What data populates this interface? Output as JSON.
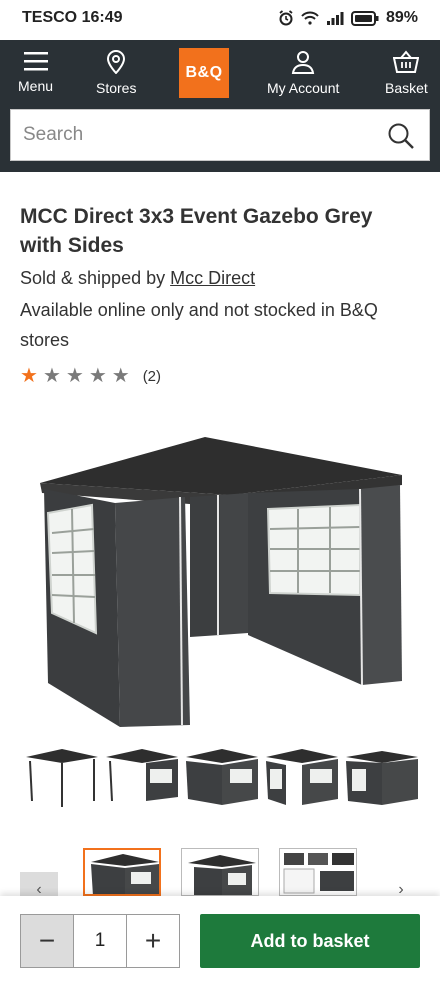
{
  "status_bar": {
    "carrier_time": "TESCO 16:49",
    "battery": "89%"
  },
  "nav": {
    "menu_label": "Menu",
    "stores_label": "Stores",
    "logo_text": "B&Q",
    "account_label": "My Account",
    "basket_label": "Basket"
  },
  "search": {
    "placeholder": "Search"
  },
  "product": {
    "title": "MCC Direct 3x3 Event Gazebo Grey with Sides",
    "sold_prefix": "Sold & shipped by ",
    "seller": "Mcc Direct",
    "availability": "Available online only and not stocked in B&Q stores",
    "rating_stars": 1,
    "rating_max": 5,
    "review_count": "(2)"
  },
  "colors": {
    "header_bg": "#2a3136",
    "brand_orange": "#f2711c",
    "add_button": "#1e7a3c"
  },
  "gallery": {
    "prev_icon": "‹",
    "next_icon": "›"
  },
  "basket_bar": {
    "minus_label": "−",
    "quantity": "1",
    "plus_label": "+",
    "add_label": "Add to basket"
  }
}
